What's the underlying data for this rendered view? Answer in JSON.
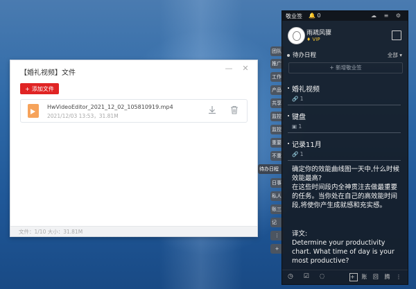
{
  "dialog": {
    "title": "【婚礼视频】文件",
    "add_button": "添加文件",
    "file": {
      "name": "HwVideoEditor_2021_12_02_105810919.mp4",
      "meta": "2021/12/03 13:53，31.81M"
    },
    "footer": "文件：1/10    大小：31.81M"
  },
  "side_tabs": [
    "团队",
    "推广",
    "工作",
    "产品",
    "共享",
    "监控",
    "监控",
    "重要",
    "不重",
    "待办日程",
    "日事",
    "私人",
    "账三",
    "记"
  ],
  "side_tab_extra": [
    "⋮",
    "+"
  ],
  "panel": {
    "brand": "敬业签",
    "count": "0",
    "top_icons": "☁ ≡ ⚙",
    "user_name": "雨疏风骤",
    "vip": "VIP",
    "section_title": "待办日程",
    "section_filter": "全部",
    "new_button": "+ 新增敬业签",
    "notes": [
      {
        "title": "婚礼视频",
        "meta": "1"
      },
      {
        "title": "键盘",
        "meta": "1"
      },
      {
        "title": "记录11月",
        "meta": "1"
      }
    ],
    "long_note": "确定你的效能曲线图一天中,什么时候效能最高?\n在这些时间段内全神贯注去做最重要的任务。当你处在自己的高效能时间段,将使你产生成就感和充实感。",
    "translation": "译文:\nDetermine your productivity chart. What time of day is your most productive?",
    "bottom_left": "◷ ☑ ◌",
    "bottom_right": "账 回 腾 ⋮"
  }
}
